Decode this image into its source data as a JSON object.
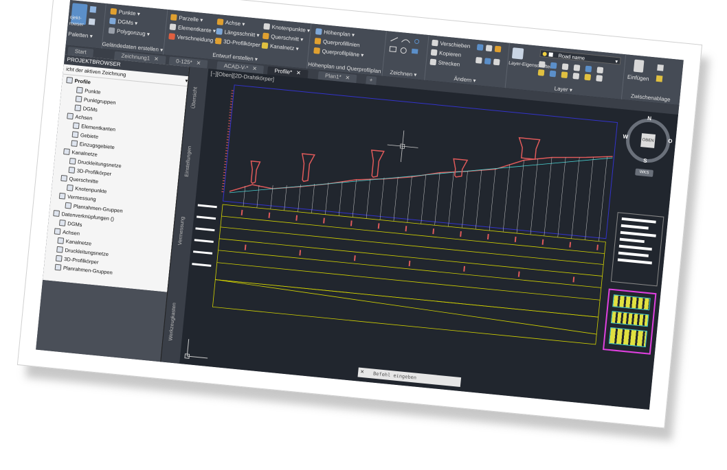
{
  "ribbon": {
    "panel1": {
      "btn1": "ojekt-",
      "btn2": "rowser",
      "label": "Paletten ▾"
    },
    "create_ground": {
      "punkte": "Punkte ▾",
      "dgms": "DGMs ▾",
      "polygonzug": "Polygonzug ▾",
      "title": "Geländedaten erstellen ▾"
    },
    "design": {
      "parzelle": "Parzelle ▾",
      "elementkante": "Elementkante ▾",
      "verschneidung": "Verschneidung ▾",
      "achse": "Achse ▾",
      "laengsschnitt": "Längsschnitt ▾",
      "profilkoerper": "3D-Profilkörper",
      "knotenpunkte": "Knotenpunkte ▾",
      "querschnitt": "Querschnitt ▾",
      "kanalnetz": "Kanalnetz ▾",
      "title": "Entwurf erstellen ▾"
    },
    "profile": {
      "hoehenplan": "Höhenplan ▾",
      "querprofillinien": "Querprofillinien",
      "querprofilplaene": "Querprofilpläne ▾",
      "title": "Höhenplan und Querprofilplan"
    },
    "draw": {
      "title": "Zeichnen ▾"
    },
    "modify": {
      "verschieben": "Verschieben",
      "kopieren": "Kopieren",
      "strecken": "Strecken",
      "title": "Ändern ▾"
    },
    "layer": {
      "btn": "Layer-Eigenschaften",
      "current": "Road name",
      "title": "Layer ▾"
    },
    "clipboard": {
      "btn": "Einfügen",
      "title": "Zwischenablage"
    }
  },
  "tabs": [
    {
      "label": "Start"
    },
    {
      "label": "Zeichnung1"
    },
    {
      "label": "0-125*"
    },
    {
      "label": "ACAD-V-*"
    },
    {
      "label": "Profile*"
    },
    {
      "label": "Plan1*"
    }
  ],
  "browser": {
    "title": "PROJEKTBROWSER",
    "subtitle": "icht der aktiven Zeichnung",
    "items": [
      {
        "label": "Profile"
      },
      {
        "label": "Punkte"
      },
      {
        "label": "Punktgruppen"
      },
      {
        "label": "DGMs"
      },
      {
        "label": "Achsen"
      },
      {
        "label": "Elementkanten"
      },
      {
        "label": "Gebiete"
      },
      {
        "label": "Einzugsgebiete"
      },
      {
        "label": "Kanalnetze"
      },
      {
        "label": "Druckleitungsnetze"
      },
      {
        "label": "3D-Profilkörper"
      },
      {
        "label": "Querschnitte"
      },
      {
        "label": "Knotenpunkte"
      },
      {
        "label": "Vermessung"
      },
      {
        "label": "Planrahmen-Gruppen"
      },
      {
        "label": "Datenverknüpfungen ()"
      },
      {
        "label": "DGMs"
      },
      {
        "label": "Achsen"
      },
      {
        "label": "Kanalnetze"
      },
      {
        "label": "Druckleitungsnetze"
      },
      {
        "label": "3D-Profilkörper"
      },
      {
        "label": "Planrahmen-Gruppen"
      }
    ]
  },
  "vtabs": [
    "Übersicht",
    "Einstellungen",
    "Vermessung",
    "Werkzeugkasten"
  ],
  "viewport": {
    "label": "[−][Oben][2D-Drahtkörper]"
  },
  "viewcube": {
    "n": "N",
    "s": "S",
    "w": "W",
    "o": "O",
    "top": "OBEN",
    "wcs": "WKS"
  },
  "command": {
    "placeholder": "Befehl eingeben",
    "header": "Befehl"
  },
  "colors": {
    "accent": "#2a6db0",
    "profile": "#e05a5a",
    "grid": "#d4d400",
    "frame": "#3333cc",
    "ribbon": "#454b55"
  }
}
